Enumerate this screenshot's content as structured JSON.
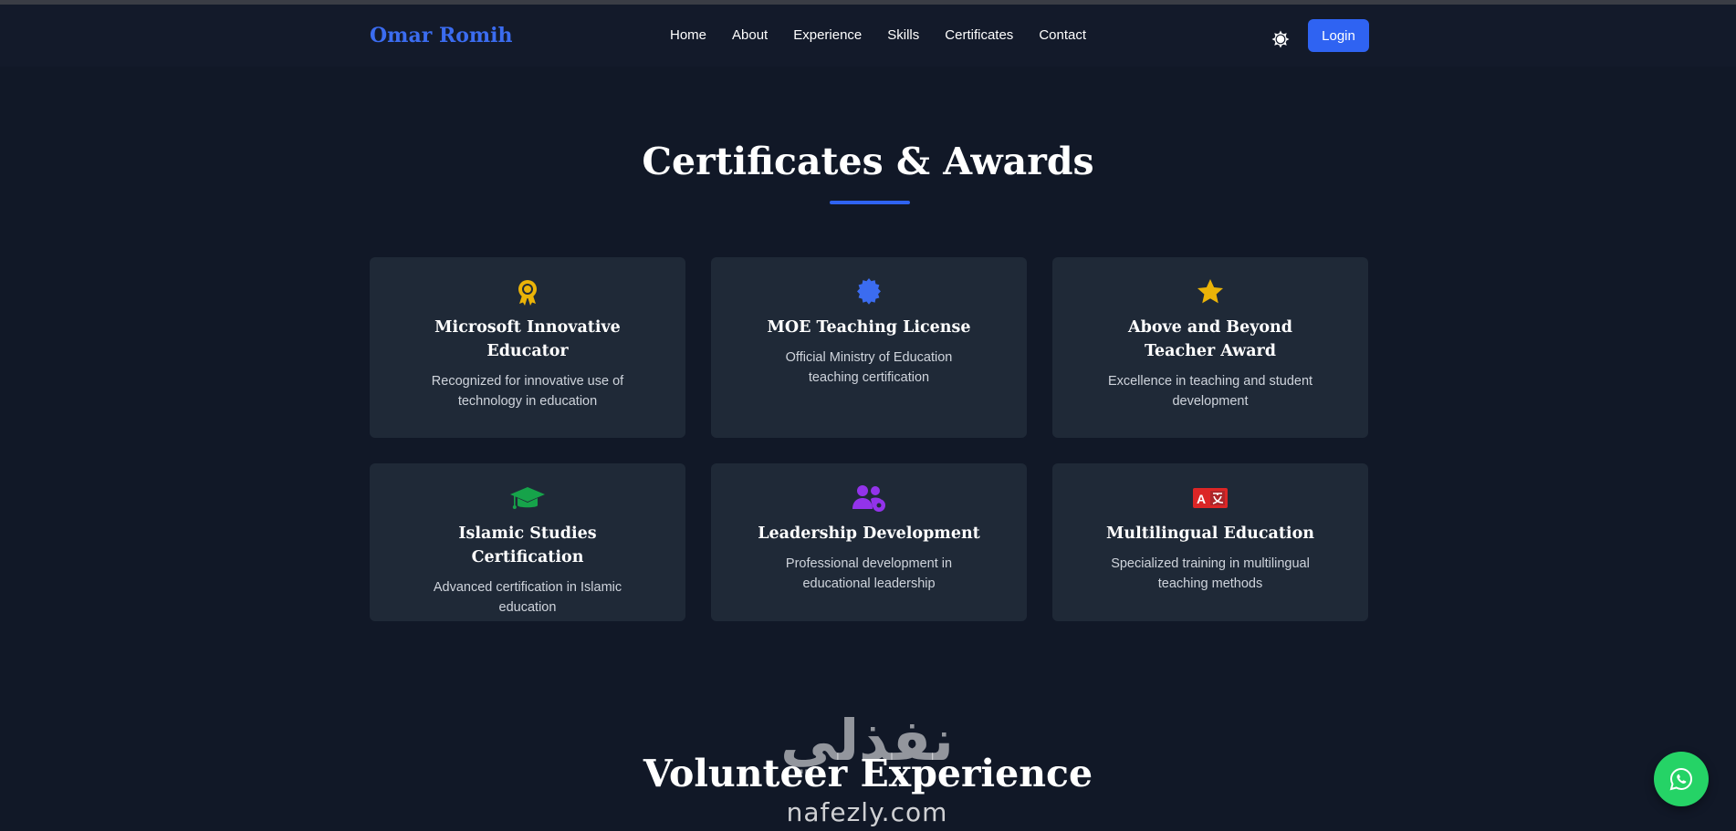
{
  "brand": {
    "name": "Omar Romih",
    "color": "#3b6cf0"
  },
  "nav": {
    "links": [
      {
        "label": "Home"
      },
      {
        "label": "About"
      },
      {
        "label": "Experience"
      },
      {
        "label": "Skills"
      },
      {
        "label": "Certificates"
      },
      {
        "label": "Contact"
      }
    ],
    "theme_toggle_icon": "sun-icon",
    "login_label": "Login"
  },
  "certificates": {
    "title": "Certificates & Awards",
    "cards": [
      {
        "icon": "award-icon",
        "icon_color": "#eab308",
        "title": "Microsoft Innovative Educator",
        "description": "Recognized for innovative use of technology in education"
      },
      {
        "icon": "certificate-icon",
        "icon_color": "#3b6cf0",
        "title": "MOE Teaching License",
        "description": "Official Ministry of Education teaching certification"
      },
      {
        "icon": "star-icon",
        "icon_color": "#eab308",
        "title": "Above and Beyond Teacher Award",
        "description": "Excellence in teaching and student development"
      },
      {
        "icon": "graduation-cap-icon",
        "icon_color": "#16a34a",
        "title": "Islamic Studies Certification",
        "description": "Advanced certification in Islamic education"
      },
      {
        "icon": "users-cog-icon",
        "icon_color": "#9333ea",
        "title": "Leadership Development",
        "description": "Professional development in educational leadership"
      },
      {
        "icon": "language-icon",
        "icon_color": "#dc2626",
        "title": "Multilingual Education",
        "description": "Specialized training in multilingual teaching methods"
      }
    ]
  },
  "volunteer": {
    "title": "Volunteer Experience"
  },
  "watermark": {
    "arabic": "نفذلي",
    "latin": "nafezly.com"
  },
  "whatsapp": {
    "icon": "whatsapp-icon",
    "color": "#25d366"
  }
}
